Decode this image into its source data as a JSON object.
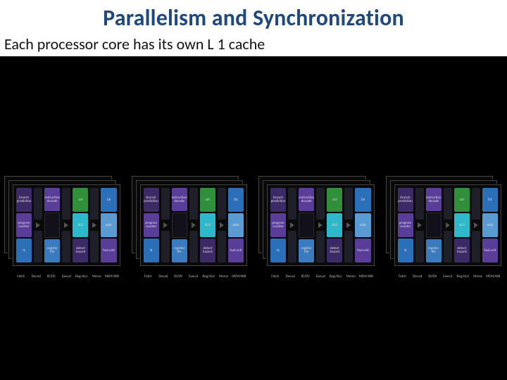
{
  "title": "Parallelism and Synchronization",
  "subtitle": "Each processor core has its own L 1 cache",
  "stage_labels": [
    "Fetch",
    "Decode",
    "ID/DV",
    "Execute",
    "Reg/ALU",
    "Memory",
    "MEM/WB"
  ],
  "core_blocks": {
    "fetch": {
      "top": "branch prediction",
      "mid": "program counter",
      "bot": "I$"
    },
    "decode": {
      "top": "instruction decode",
      "bot": "register file"
    },
    "execute": {
      "top": "ctrl",
      "mid": "ALU",
      "bot": "detect hazard"
    },
    "memory": {
      "top": "D$",
      "mid": "addr",
      "bot": "fwd unit"
    }
  },
  "cores": [
    {
      "id": "core0"
    },
    {
      "id": "core1"
    },
    {
      "id": "core2"
    },
    {
      "id": "core3"
    }
  ]
}
